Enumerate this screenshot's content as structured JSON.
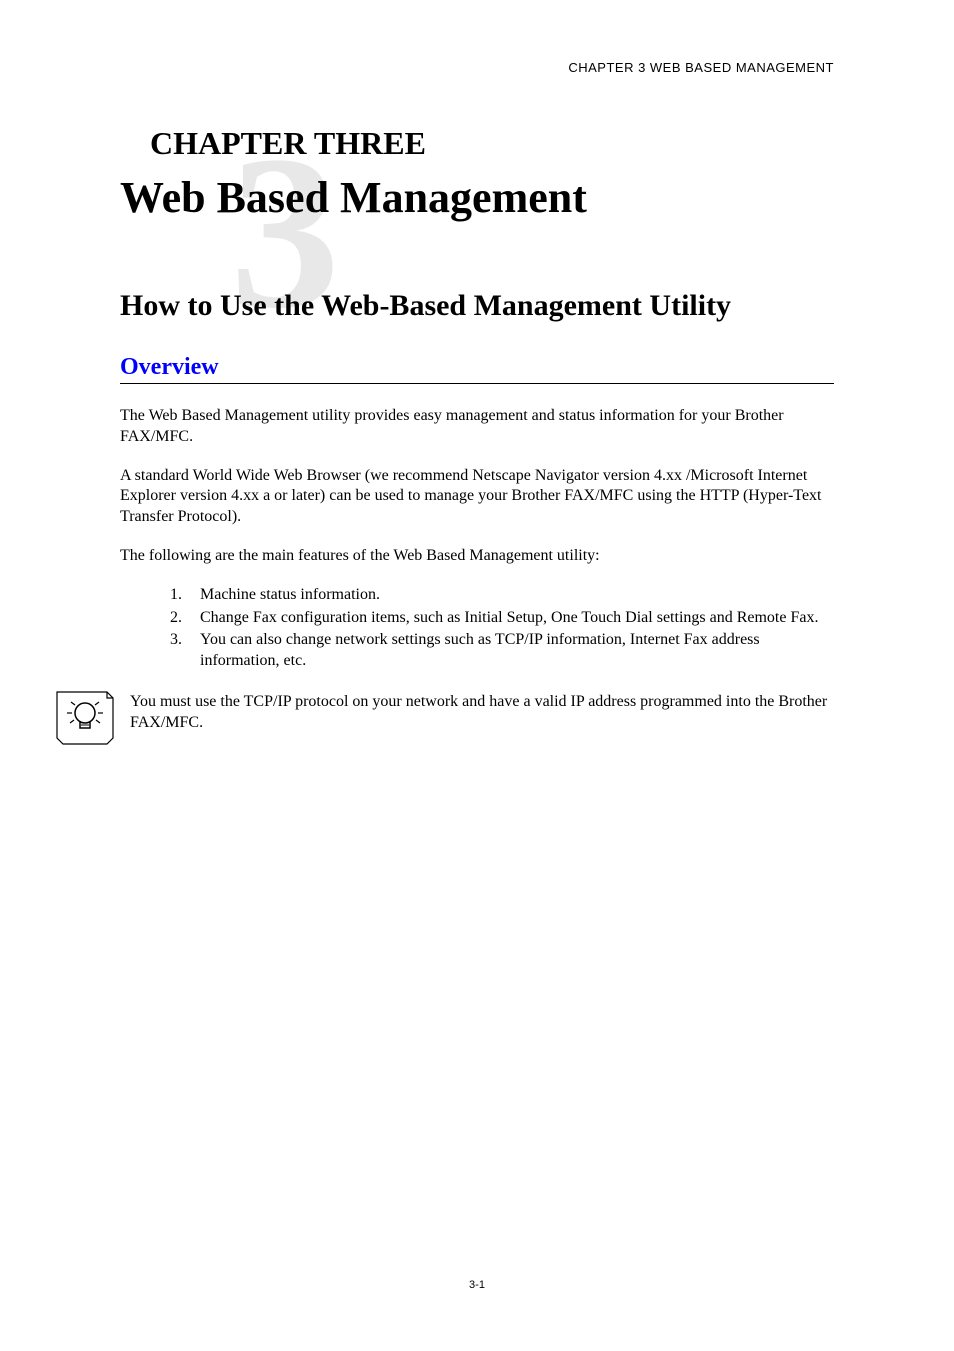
{
  "running_header": "CHAPTER 3 WEB BASED MANAGEMENT",
  "chapter_label": "CHAPTER THREE",
  "chapter_bg_number": "3",
  "chapter_title": "Web Based Management",
  "section_title": "How to Use the Web-Based Management Utility",
  "subsection_title": "Overview",
  "paragraphs": {
    "p1": "The Web Based Management utility provides easy management and status information for your Brother FAX/MFC.",
    "p2": "A standard World Wide Web Browser (we recommend Netscape Navigator version 4.xx /Microsoft Internet Explorer version 4.xx a or later) can be used to manage your Brother FAX/MFC using the HTTP (Hyper-Text Transfer Protocol).",
    "p3": "The following are the main features of the Web Based Management utility:"
  },
  "list": [
    {
      "num": "1.",
      "text": "Machine status information."
    },
    {
      "num": "2.",
      "text": "Change Fax configuration items, such as Initial Setup, One Touch Dial settings and Remote Fax."
    },
    {
      "num": "3.",
      "text": "You can also change network settings such as TCP/IP information, Internet Fax address information, etc."
    }
  ],
  "note_text": "You must use the TCP/IP protocol on your network and have a valid IP address programmed into the Brother FAX/MFC.",
  "page_number": "3-1"
}
